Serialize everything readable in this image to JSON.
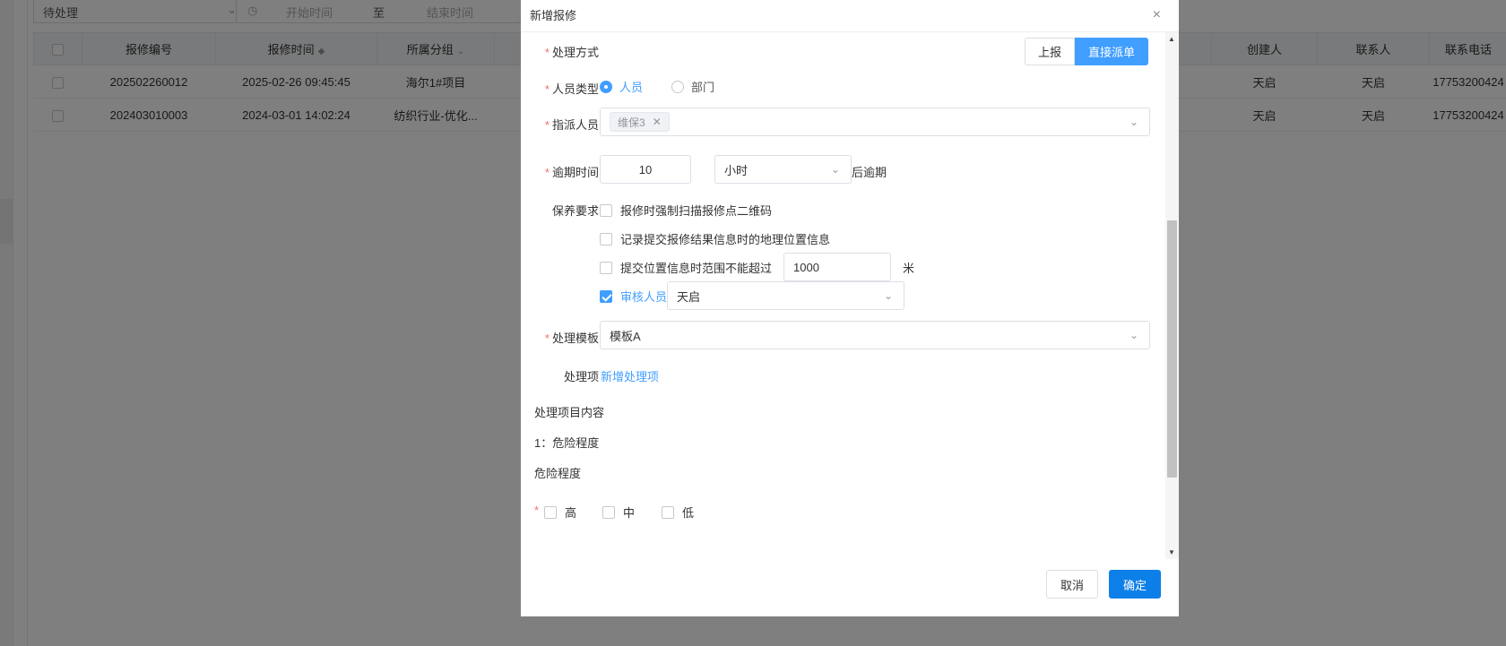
{
  "background": {
    "status_select": "待处理",
    "date_start_placeholder": "开始时间",
    "date_separator": "至",
    "date_end_placeholder": "结束时间",
    "table": {
      "headers": [
        "",
        "报修编号",
        "报修时间",
        "所属分组",
        "",
        "创建人",
        "联系人",
        "联系电话"
      ],
      "rows": [
        {
          "id": "202502260012",
          "time": "2025-02-26 09:45:45",
          "group": "海尔1#项目",
          "creator": "天启",
          "contact": "天启",
          "phone": "17753200424"
        },
        {
          "id": "202403010003",
          "time": "2024-03-01 14:02:24",
          "group": "纺织行业-优化...",
          "creator": "天启",
          "contact": "天启",
          "phone": "17753200424"
        }
      ]
    }
  },
  "modal": {
    "title": "新增报修",
    "form": {
      "handle_method_label": "处理方式",
      "handle_method_options": [
        "上报",
        "直接派单"
      ],
      "handle_method_selected": "直接派单",
      "person_type_label": "人员类型",
      "person_type_options": [
        "人员",
        "部门"
      ],
      "assign_label": "指派人员",
      "assign_tag": "维保3",
      "overdue_label": "逾期时间",
      "overdue_value": "10",
      "overdue_unit": "小时",
      "overdue_suffix": "后逾期",
      "maintenance_label": "保养要求",
      "req_scan": "报修时强制扫描报修点二维码",
      "req_location": "记录提交报修结果信息时的地理位置信息",
      "req_range": "提交位置信息时范围不能超过",
      "range_value": "1000",
      "range_unit": "米",
      "req_reviewer": "审核人员",
      "reviewer_value": "天启",
      "template_label": "处理模板",
      "template_value": "模板A",
      "item_label": "处理项",
      "add_item_link": "新增处理项",
      "content_title": "处理项目内容",
      "content_item": "1：危险程度",
      "danger_title": "危险程度",
      "danger_options": [
        "高",
        "中",
        "低"
      ]
    },
    "cancel_label": "取消",
    "ok_label": "确定"
  },
  "colors": {
    "primary": "#409eff",
    "ok_button": "#0d7fe8",
    "required": "#f56c6c"
  }
}
